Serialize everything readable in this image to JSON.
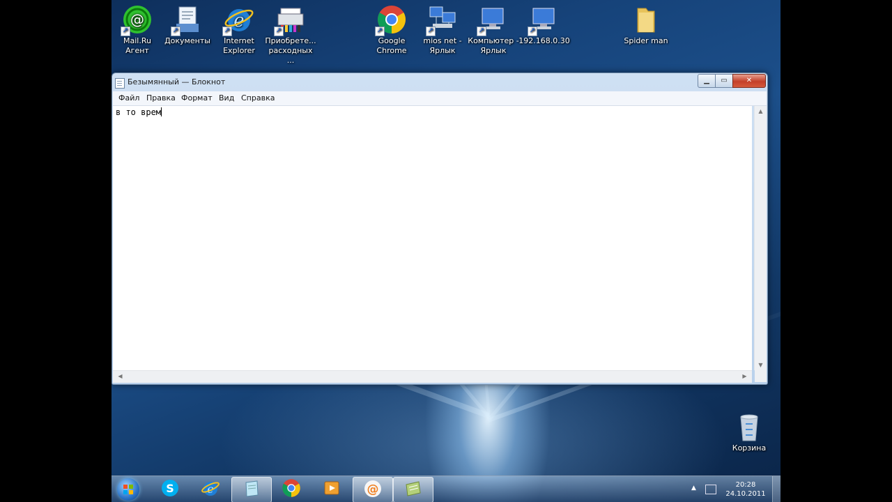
{
  "desktop": {
    "icons": [
      {
        "label": "Mail.Ru Агент",
        "icon": "mailru-agent-icon",
        "color": "#2fc12f"
      },
      {
        "label": "Документы",
        "icon": "documents-icon",
        "color": "#d8e6f6"
      },
      {
        "label": "Internet Explorer",
        "icon": "internet-explorer-icon",
        "color": "#1f7fd6"
      },
      {
        "label": "Приобрете... расходных ...",
        "icon": "printer-icon",
        "color": "#dfe3e8"
      },
      {
        "label": "Google Chrome",
        "icon": "google-chrome-icon",
        "color": "#db4437"
      },
      {
        "label": "mios net - Ярлык",
        "icon": "network-icon",
        "color": "#3b7bd8"
      },
      {
        "label": "Компьютер - Ярлык",
        "icon": "computer-icon",
        "color": "#3b7bd8"
      },
      {
        "label": "192.168.0.30",
        "icon": "computer-icon",
        "color": "#3b7bd8"
      },
      {
        "label": "Spider man",
        "icon": "folder-icon",
        "color": "#e8c35a"
      }
    ],
    "recycle_bin_label": "Корзина"
  },
  "notepad": {
    "title": "Безымянный — Блокнот",
    "menu": [
      "Файл",
      "Правка",
      "Формат",
      "Вид",
      "Справка"
    ],
    "content": "в то врем"
  },
  "taskbar": {
    "items": [
      {
        "icon": "skype-icon",
        "active": false
      },
      {
        "icon": "internet-explorer-icon",
        "active": false
      },
      {
        "icon": "notepad-icon",
        "active": true
      },
      {
        "icon": "google-chrome-icon",
        "active": false
      },
      {
        "icon": "media-player-icon",
        "active": false
      },
      {
        "icon": "mailru-agent-icon",
        "active": true
      },
      {
        "icon": "unknown-app-icon",
        "active": true
      }
    ],
    "clock_time": "20:28",
    "clock_date": "24.10.2011"
  }
}
